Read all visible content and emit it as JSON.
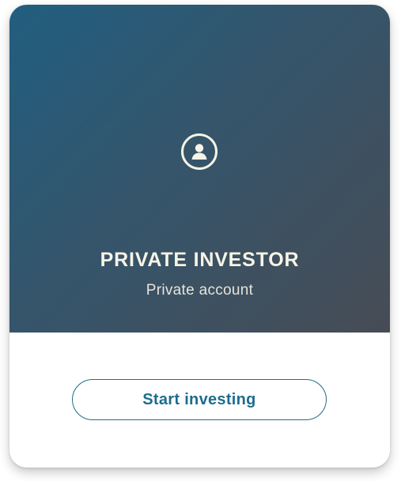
{
  "card": {
    "icon": "user-circle-icon",
    "title": "PRIVATE INVESTOR",
    "subtitle": "Private account",
    "cta_label": "Start investing"
  },
  "colors": {
    "gradient_start": "#215e80",
    "gradient_end": "#474c55",
    "title_text": "#f7f4e6",
    "accent": "#1d6c8e",
    "card_background": "#ffffff"
  }
}
